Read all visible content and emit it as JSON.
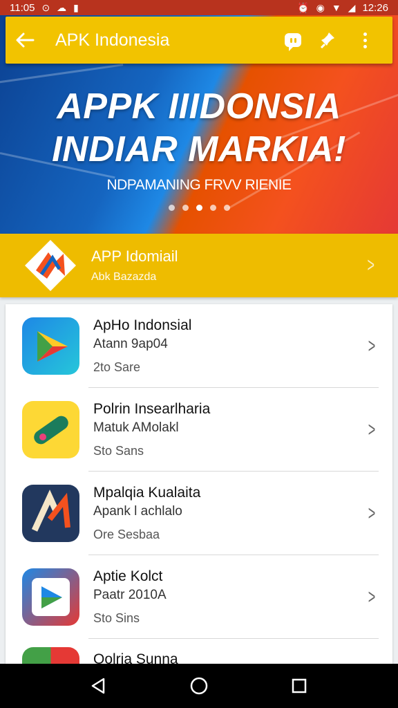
{
  "status_bar": {
    "time_left": "11:05",
    "time_right": "12:26"
  },
  "app_bar": {
    "title": "APK Indonesia"
  },
  "hero": {
    "title_line1": "APPK IIIDONSIA",
    "title_line2": "INDIAR MARKIA!",
    "subtitle": "NDPAMANING FRVV RIENIE",
    "slides": 5,
    "active_slide": 2
  },
  "featured": {
    "title": "APP Idomiail",
    "subtitle": "Abk Bazazda"
  },
  "apps": [
    {
      "name": "ApHo Indonsial",
      "developer": "Atann 9ap04",
      "meta": "2to Sare",
      "icon": "play-triangle-icon"
    },
    {
      "name": "Polrin Insearlharia",
      "developer": "Matuk AMolakl",
      "meta": "Sto Sans",
      "icon": "bandage-icon"
    },
    {
      "name": "Mpalqia Kualaita",
      "developer": "Apank l achlalo",
      "meta": "Ore Sesbaa",
      "icon": "letter-a-icon"
    },
    {
      "name": "Aptie Kolct",
      "developer": "Paatr 2010A",
      "meta": "Sto Sins",
      "icon": "play-square-icon"
    },
    {
      "name": "Oolria Sunna",
      "developer": "",
      "meta": "",
      "icon": "chrome-like-icon"
    }
  ],
  "colors": {
    "app_bar": "#f2c300",
    "featured_bg": "#eebc00",
    "hero_blue": "#1565c0",
    "hero_orange": "#f4511e"
  }
}
